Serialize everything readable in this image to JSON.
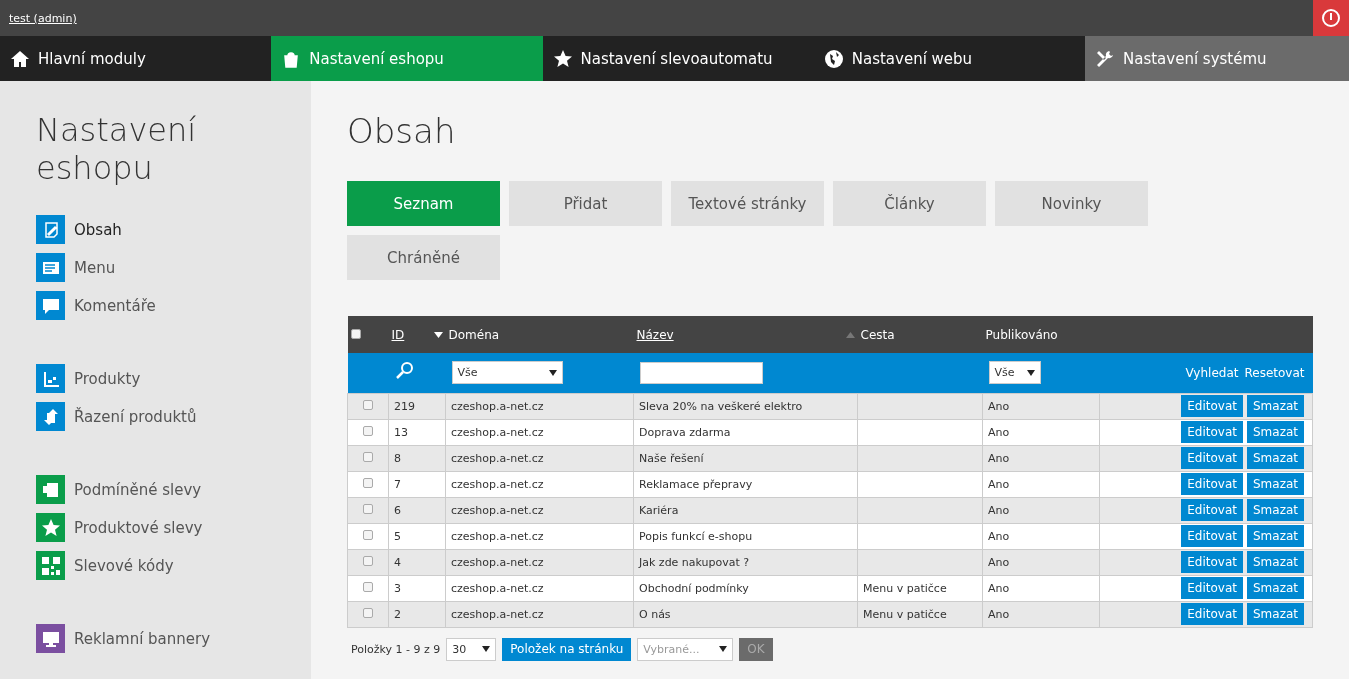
{
  "user_link": "test (admin)",
  "nav": [
    {
      "label": "Hlavní moduly",
      "kind": "home",
      "selected": false
    },
    {
      "label": "Nastavení eshopu",
      "kind": "bag",
      "selected": true
    },
    {
      "label": "Nastavení slevoautomatu",
      "kind": "star",
      "selected": false
    },
    {
      "label": "Nastavení webu",
      "kind": "globe",
      "selected": false
    },
    {
      "label": "Nastavení systému",
      "kind": "tools",
      "selected": false
    }
  ],
  "sidebar": {
    "title": "Nastavení eshopu",
    "groups": [
      [
        {
          "label": "Obsah",
          "kind": "edit",
          "color": "#0088d1",
          "selected": true
        },
        {
          "label": "Menu",
          "kind": "menu",
          "color": "#0088d1",
          "selected": false
        },
        {
          "label": "Komentáře",
          "kind": "comment",
          "color": "#0088d1",
          "selected": false
        }
      ],
      [
        {
          "label": "Produkty",
          "kind": "chart",
          "color": "#0088d1",
          "selected": false
        },
        {
          "label": "Řazení produktů",
          "kind": "sort",
          "color": "#0088d1",
          "selected": false
        }
      ],
      [
        {
          "label": "Podmíněné slevy",
          "kind": "mug",
          "color": "#0a9d4a",
          "selected": false
        },
        {
          "label": "Produktové slevy",
          "kind": "star",
          "color": "#0a9d4a",
          "selected": false
        },
        {
          "label": "Slevové kódy",
          "kind": "qr",
          "color": "#0a9d4a",
          "selected": false
        }
      ],
      [
        {
          "label": "Reklamní bannery",
          "kind": "monitor",
          "color": "#7b4fa0",
          "selected": false
        }
      ]
    ]
  },
  "page_title": "Obsah",
  "tabs": [
    {
      "label": "Seznam",
      "selected": true
    },
    {
      "label": "Přidat",
      "selected": false
    },
    {
      "label": "Textové stránky",
      "selected": false
    },
    {
      "label": "Články",
      "selected": false
    },
    {
      "label": "Novinky",
      "selected": false
    },
    {
      "label": "Chráněné",
      "selected": false
    }
  ],
  "table": {
    "select_all": {
      "checked": false
    },
    "columns": [
      {
        "label": "ID",
        "kind": "link",
        "sort_desc": true,
        "sort_asc": false
      },
      {
        "label": "Doména",
        "kind": "plain",
        "sort_desc": false,
        "sort_asc": false
      },
      {
        "label": "Název",
        "kind": "link",
        "sort_desc": false,
        "sort_asc": true
      },
      {
        "label": "Cesta",
        "kind": "plain",
        "sort_desc": false,
        "sort_asc": false
      },
      {
        "label": "Publikováno",
        "kind": "plain",
        "sort_desc": false,
        "sort_asc": false
      }
    ],
    "filters": {
      "domain": "Vše",
      "published": "Vše",
      "search": "Vyhledat",
      "reset": "Resetovat"
    },
    "rows": [
      {
        "checked": false,
        "cells": [
          "219",
          "czeshop.a-net.cz",
          "Sleva 20% na veškeré elektro",
          "",
          "Ano"
        ],
        "edit": "Editovat",
        "delete": "Smazat"
      },
      {
        "checked": false,
        "cells": [
          "13",
          "czeshop.a-net.cz",
          "Doprava zdarma",
          "",
          "Ano"
        ],
        "edit": "Editovat",
        "delete": "Smazat"
      },
      {
        "checked": false,
        "cells": [
          "8",
          "czeshop.a-net.cz",
          "Naše řešení",
          "",
          "Ano"
        ],
        "edit": "Editovat",
        "delete": "Smazat"
      },
      {
        "checked": false,
        "cells": [
          "7",
          "czeshop.a-net.cz",
          "Reklamace přepravy",
          "",
          "Ano"
        ],
        "edit": "Editovat",
        "delete": "Smazat"
      },
      {
        "checked": false,
        "cells": [
          "6",
          "czeshop.a-net.cz",
          "Kariéra",
          "",
          "Ano"
        ],
        "edit": "Editovat",
        "delete": "Smazat"
      },
      {
        "checked": false,
        "cells": [
          "5",
          "czeshop.a-net.cz",
          "Popis funkcí e-shopu",
          "",
          "Ano"
        ],
        "edit": "Editovat",
        "delete": "Smazat"
      },
      {
        "checked": false,
        "cells": [
          "4",
          "czeshop.a-net.cz",
          "Jak zde nakupovat ?",
          "",
          "Ano"
        ],
        "edit": "Editovat",
        "delete": "Smazat"
      },
      {
        "checked": false,
        "cells": [
          "3",
          "czeshop.a-net.cz",
          "Obchodní podmínky",
          "Menu v patičce",
          "Ano"
        ],
        "edit": "Editovat",
        "delete": "Smazat"
      },
      {
        "checked": false,
        "cells": [
          "2",
          "czeshop.a-net.cz",
          "O nás",
          "Menu v patičce",
          "Ano"
        ],
        "edit": "Editovat",
        "delete": "Smazat"
      }
    ]
  },
  "footer": {
    "count": "Položky 1 - 9 z 9",
    "per_page": "30",
    "per_page_button": "Položek na stránku",
    "bulk_placeholder": "Vybrané...",
    "ok": "OK"
  }
}
